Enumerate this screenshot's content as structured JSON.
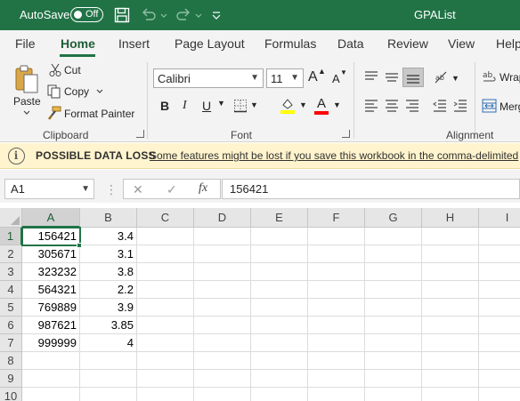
{
  "titlebar": {
    "autosave_label": "AutoSave",
    "autosave_state": "Off",
    "doc_title": "GPAList",
    "color": "#217346"
  },
  "tabs": [
    "File",
    "Home",
    "Insert",
    "Page Layout",
    "Formulas",
    "Data",
    "Review",
    "View",
    "Help"
  ],
  "active_tab": "Home",
  "ribbon": {
    "clipboard": {
      "paste": "Paste",
      "cut": "Cut",
      "copy": "Copy",
      "format_painter": "Format Painter",
      "group_label": "Clipboard"
    },
    "font": {
      "font_name": "Calibri",
      "font_size": "11",
      "grow": "A",
      "shrink": "A",
      "bold": "B",
      "italic": "I",
      "underline": "U",
      "font_color_letter": "A",
      "group_label": "Font",
      "highlight_color": "#ffff00",
      "font_color": "#ff0000"
    },
    "alignment": {
      "wrap": "Wrap",
      "merge": "Merg",
      "group_label": "Alignment"
    }
  },
  "message": {
    "icon": "i",
    "title": "POSSIBLE DATA LOSS",
    "text": "Some features might be lost if you save this workbook in the comma-delimited"
  },
  "formula_bar": {
    "name_box": "A1",
    "cancel": "✕",
    "enter": "✓",
    "fx": "fx",
    "value": "156421"
  },
  "sheet": {
    "columns": [
      "A",
      "B",
      "C",
      "D",
      "E",
      "F",
      "G",
      "H",
      "I"
    ],
    "rows": [
      "1",
      "2",
      "3",
      "4",
      "5",
      "6",
      "7",
      "8",
      "9",
      "10"
    ],
    "cells": [
      [
        "156421",
        "3.4"
      ],
      [
        "305671",
        "3.1"
      ],
      [
        "323232",
        "3.8"
      ],
      [
        "564321",
        "2.2"
      ],
      [
        "769889",
        "3.9"
      ],
      [
        "987621",
        "3.85"
      ],
      [
        "999999",
        "4"
      ]
    ],
    "selected_cell": "A1"
  }
}
